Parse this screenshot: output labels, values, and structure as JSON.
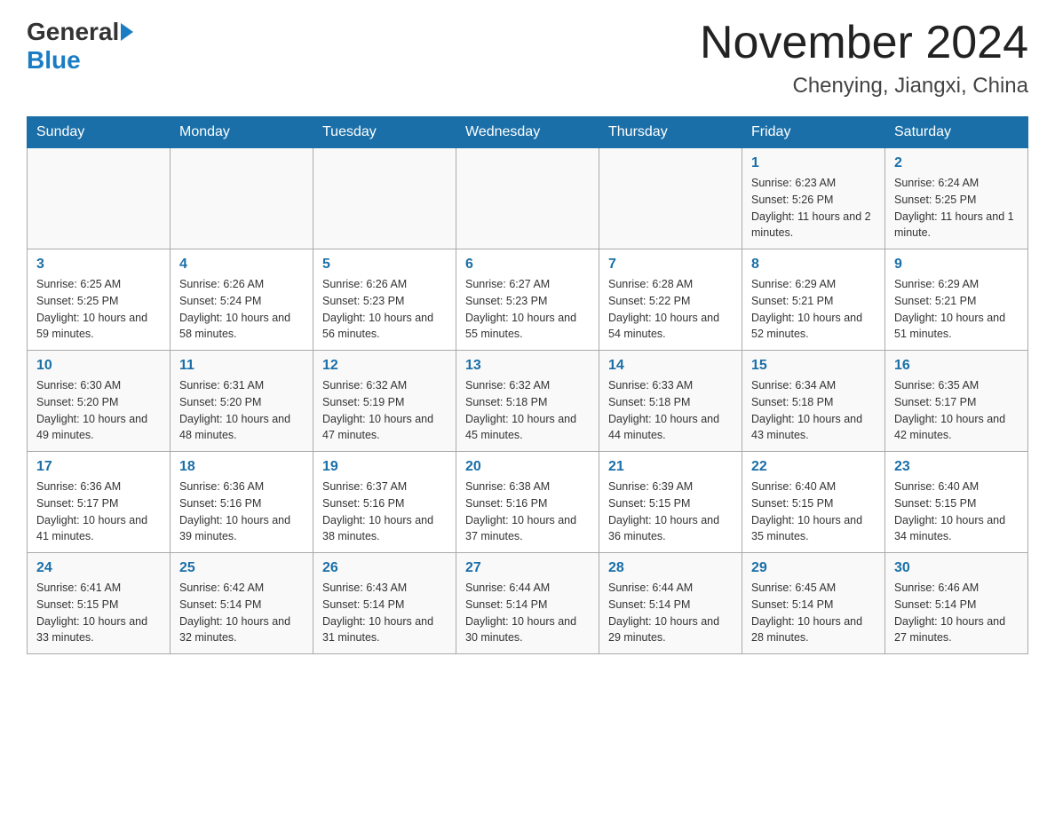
{
  "header": {
    "logo_general": "General",
    "logo_blue": "Blue",
    "month_title": "November 2024",
    "location": "Chenying, Jiangxi, China"
  },
  "days_of_week": [
    "Sunday",
    "Monday",
    "Tuesday",
    "Wednesday",
    "Thursday",
    "Friday",
    "Saturday"
  ],
  "weeks": [
    {
      "cells": [
        {
          "day": "",
          "info": ""
        },
        {
          "day": "",
          "info": ""
        },
        {
          "day": "",
          "info": ""
        },
        {
          "day": "",
          "info": ""
        },
        {
          "day": "",
          "info": ""
        },
        {
          "day": "1",
          "info": "Sunrise: 6:23 AM\nSunset: 5:26 PM\nDaylight: 11 hours and 2 minutes."
        },
        {
          "day": "2",
          "info": "Sunrise: 6:24 AM\nSunset: 5:25 PM\nDaylight: 11 hours and 1 minute."
        }
      ]
    },
    {
      "cells": [
        {
          "day": "3",
          "info": "Sunrise: 6:25 AM\nSunset: 5:25 PM\nDaylight: 10 hours and 59 minutes."
        },
        {
          "day": "4",
          "info": "Sunrise: 6:26 AM\nSunset: 5:24 PM\nDaylight: 10 hours and 58 minutes."
        },
        {
          "day": "5",
          "info": "Sunrise: 6:26 AM\nSunset: 5:23 PM\nDaylight: 10 hours and 56 minutes."
        },
        {
          "day": "6",
          "info": "Sunrise: 6:27 AM\nSunset: 5:23 PM\nDaylight: 10 hours and 55 minutes."
        },
        {
          "day": "7",
          "info": "Sunrise: 6:28 AM\nSunset: 5:22 PM\nDaylight: 10 hours and 54 minutes."
        },
        {
          "day": "8",
          "info": "Sunrise: 6:29 AM\nSunset: 5:21 PM\nDaylight: 10 hours and 52 minutes."
        },
        {
          "day": "9",
          "info": "Sunrise: 6:29 AM\nSunset: 5:21 PM\nDaylight: 10 hours and 51 minutes."
        }
      ]
    },
    {
      "cells": [
        {
          "day": "10",
          "info": "Sunrise: 6:30 AM\nSunset: 5:20 PM\nDaylight: 10 hours and 49 minutes."
        },
        {
          "day": "11",
          "info": "Sunrise: 6:31 AM\nSunset: 5:20 PM\nDaylight: 10 hours and 48 minutes."
        },
        {
          "day": "12",
          "info": "Sunrise: 6:32 AM\nSunset: 5:19 PM\nDaylight: 10 hours and 47 minutes."
        },
        {
          "day": "13",
          "info": "Sunrise: 6:32 AM\nSunset: 5:18 PM\nDaylight: 10 hours and 45 minutes."
        },
        {
          "day": "14",
          "info": "Sunrise: 6:33 AM\nSunset: 5:18 PM\nDaylight: 10 hours and 44 minutes."
        },
        {
          "day": "15",
          "info": "Sunrise: 6:34 AM\nSunset: 5:18 PM\nDaylight: 10 hours and 43 minutes."
        },
        {
          "day": "16",
          "info": "Sunrise: 6:35 AM\nSunset: 5:17 PM\nDaylight: 10 hours and 42 minutes."
        }
      ]
    },
    {
      "cells": [
        {
          "day": "17",
          "info": "Sunrise: 6:36 AM\nSunset: 5:17 PM\nDaylight: 10 hours and 41 minutes."
        },
        {
          "day": "18",
          "info": "Sunrise: 6:36 AM\nSunset: 5:16 PM\nDaylight: 10 hours and 39 minutes."
        },
        {
          "day": "19",
          "info": "Sunrise: 6:37 AM\nSunset: 5:16 PM\nDaylight: 10 hours and 38 minutes."
        },
        {
          "day": "20",
          "info": "Sunrise: 6:38 AM\nSunset: 5:16 PM\nDaylight: 10 hours and 37 minutes."
        },
        {
          "day": "21",
          "info": "Sunrise: 6:39 AM\nSunset: 5:15 PM\nDaylight: 10 hours and 36 minutes."
        },
        {
          "day": "22",
          "info": "Sunrise: 6:40 AM\nSunset: 5:15 PM\nDaylight: 10 hours and 35 minutes."
        },
        {
          "day": "23",
          "info": "Sunrise: 6:40 AM\nSunset: 5:15 PM\nDaylight: 10 hours and 34 minutes."
        }
      ]
    },
    {
      "cells": [
        {
          "day": "24",
          "info": "Sunrise: 6:41 AM\nSunset: 5:15 PM\nDaylight: 10 hours and 33 minutes."
        },
        {
          "day": "25",
          "info": "Sunrise: 6:42 AM\nSunset: 5:14 PM\nDaylight: 10 hours and 32 minutes."
        },
        {
          "day": "26",
          "info": "Sunrise: 6:43 AM\nSunset: 5:14 PM\nDaylight: 10 hours and 31 minutes."
        },
        {
          "day": "27",
          "info": "Sunrise: 6:44 AM\nSunset: 5:14 PM\nDaylight: 10 hours and 30 minutes."
        },
        {
          "day": "28",
          "info": "Sunrise: 6:44 AM\nSunset: 5:14 PM\nDaylight: 10 hours and 29 minutes."
        },
        {
          "day": "29",
          "info": "Sunrise: 6:45 AM\nSunset: 5:14 PM\nDaylight: 10 hours and 28 minutes."
        },
        {
          "day": "30",
          "info": "Sunrise: 6:46 AM\nSunset: 5:14 PM\nDaylight: 10 hours and 27 minutes."
        }
      ]
    }
  ]
}
